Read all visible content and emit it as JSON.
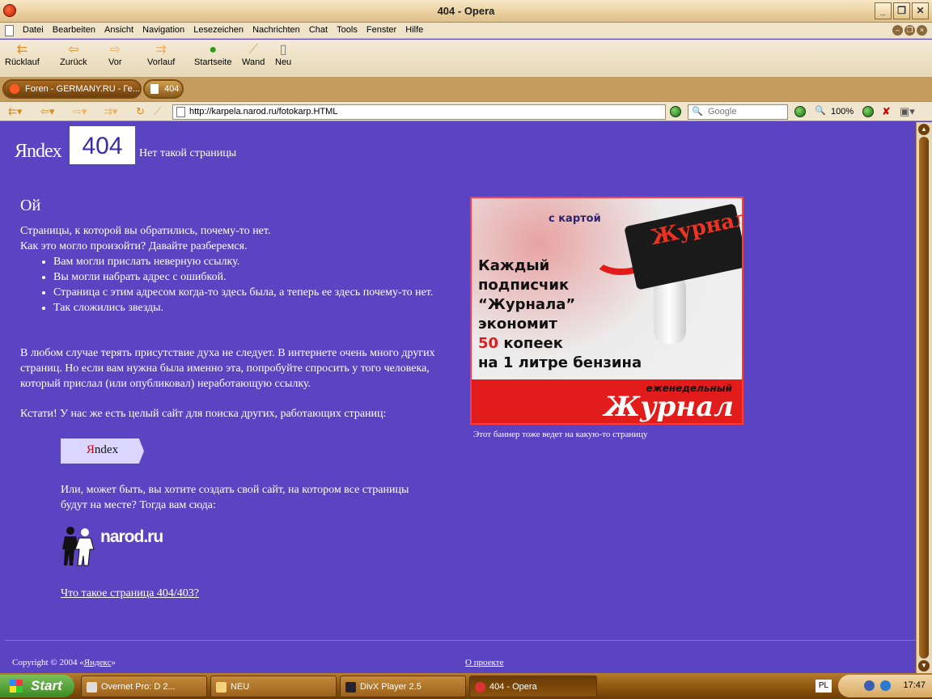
{
  "window": {
    "title": "404 - Opera",
    "buttons": [
      "_",
      "❐",
      "✕"
    ]
  },
  "menu": [
    "Datei",
    "Bearbeiten",
    "Ansicht",
    "Navigation",
    "Lesezeichen",
    "Nachrichten",
    "Chat",
    "Tools",
    "Fenster",
    "Hilfe"
  ],
  "toolbar": [
    {
      "label": "Rücklauf",
      "icon": "rewind-icon"
    },
    {
      "label": "Zurück",
      "icon": "back-icon"
    },
    {
      "label": "Vor",
      "icon": "forward-icon"
    },
    {
      "label": "Vorlauf",
      "icon": "fast-forward-icon"
    },
    {
      "label": "Startseite",
      "icon": "home-icon"
    },
    {
      "label": "Wand",
      "icon": "wand-icon"
    },
    {
      "label": "Neu",
      "icon": "new-page-icon"
    }
  ],
  "tabs": [
    {
      "label": "Foren - GERMANY.RU - Ге..."
    },
    {
      "label": "404"
    }
  ],
  "address": {
    "url": "http://karpela.narod.ru/fotokarp.HTML",
    "search_placeholder": "Google",
    "zoom": "100%"
  },
  "page": {
    "logo": "Яndex",
    "code": "404",
    "not_found": "Нет такой страницы",
    "oops": "Ой",
    "intro1": "Страницы, к которой вы обратились, почему-то нет.",
    "intro2": "Как это могло произойти? Давайте разберемся.",
    "bullets": [
      "Вам могли прислать неверную ссылку.",
      "Вы могли набрать адрес с ошибкой.",
      "Страница с этим адресом когда-то здесь была, а теперь ее здесь почему-то нет.",
      "Так сложились звезды."
    ],
    "para2": "В любом случае терять присутствие духа не следует. В интернете очень много других страниц. Но если вам нужна была именно эта, попробуйте спросить у того человека, который прислал (или опубликовал) неработающую ссылку.",
    "para3": "Кстати! У нас же есть целый сайт для поиска других, работающих страниц:",
    "yandex_btn_y": "Я",
    "yandex_btn_rest": "ndex",
    "para4": "Или, может быть, вы хотите создать свой сайт, на котором все страницы будут на месте? Тогда вам сюда:",
    "narod": "narod.ru",
    "link404": "Что такое страница 404/403?",
    "banner": {
      "with_card": "с картой",
      "line1": "Каждый",
      "line2": "подписчик",
      "line3": "“Журнала”",
      "line4": "экономит",
      "line5_num": "50",
      "line5_rest": " копеек",
      "line6": "на 1 литре бензина",
      "weekly": "еженедельный",
      "brand": "Журнал",
      "card": "Журнал"
    },
    "banner_caption": "Этот баннер тоже ведет на какую-то страницу",
    "copyright_prefix": "Copyright © 2004 «",
    "copyright_link": "Яндекс",
    "copyright_suffix": "»",
    "about": "О проекте"
  },
  "taskbar": {
    "start": "Start",
    "tasks": [
      {
        "label": "Overnet Pro: D 2..."
      },
      {
        "label": "NEU"
      },
      {
        "label": "DivX Player 2.5"
      },
      {
        "label": "404 - Opera"
      }
    ],
    "lang": "PL",
    "clock": "17:47"
  }
}
